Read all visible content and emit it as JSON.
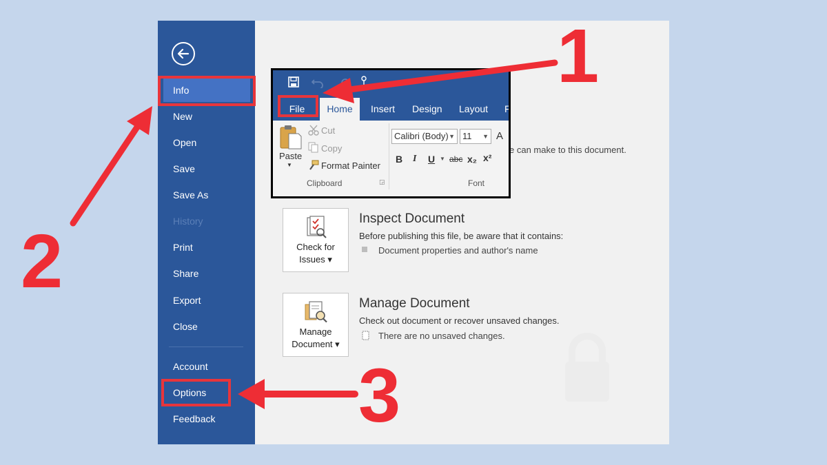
{
  "sidebar": {
    "items": [
      {
        "label": "Info"
      },
      {
        "label": "New"
      },
      {
        "label": "Open"
      },
      {
        "label": "Save"
      },
      {
        "label": "Save As"
      },
      {
        "label": "History"
      },
      {
        "label": "Print"
      },
      {
        "label": "Share"
      },
      {
        "label": "Export"
      },
      {
        "label": "Close"
      },
      {
        "label": "Account"
      },
      {
        "label": "Options"
      },
      {
        "label": "Feedback"
      }
    ],
    "back_icon": "arrow-left-circle-icon"
  },
  "info": {
    "properties_fragment": "e can make to this document.",
    "inspect": {
      "tile_line1": "Check for",
      "tile_line2": "Issues ▾",
      "title": "Inspect Document",
      "description": "Before publishing this file, be aware that it contains:",
      "bullet": "Document properties and author's name"
    },
    "manage": {
      "tile_line1": "Manage",
      "tile_line2": "Document ▾",
      "title": "Manage Document",
      "description": "Check out document or recover unsaved changes.",
      "bullet": "There are no unsaved changes."
    }
  },
  "ribbon": {
    "tabs": [
      "File",
      "Home",
      "Insert",
      "Design",
      "Layout",
      "F"
    ],
    "clipboard": {
      "paste": "Paste",
      "cut": "Cut",
      "copy": "Copy",
      "format_painter": "Format Painter",
      "group_label": "Clipboard"
    },
    "font": {
      "family": "Calibri (Body)",
      "size": "11",
      "grow_icon_text": "A",
      "bold": "B",
      "italic": "I",
      "underline": "U",
      "strike": "abc",
      "sub": "x₂",
      "sup": "x²",
      "group_label": "Font"
    }
  },
  "annotations": {
    "step1": "1",
    "step2": "2",
    "step3": "3",
    "color": "#ee2d35"
  },
  "colors": {
    "word_blue": "#2b579a",
    "active_blue": "#4472c4",
    "background": "#c5d6ec"
  }
}
